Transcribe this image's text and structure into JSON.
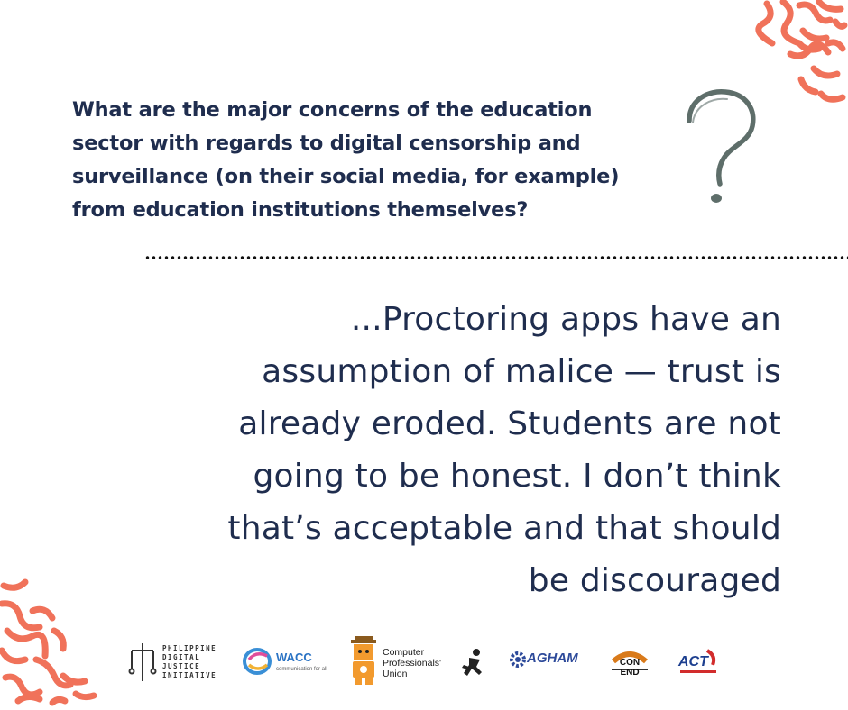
{
  "question": "What are the major concerns of the education\nsector with regards to digital censorship and\nsurveillance (on their social media, for example)\nfrom education institutions themselves?",
  "quote": "...Proctoring apps have an\nassumption of malice — trust is\nalready eroded. Students are not\ngoing to be honest. I don’t think\nthat’s acceptable and that should\nbe discouraged",
  "logos": {
    "pdji": "PHILIPPINE\nDIGITAL\nJUSTICE\nINITIATIVE",
    "wacc_name": "WACC",
    "wacc_tagline": "communication for all",
    "cpu": "Computer\nProfessionals'\nUnion",
    "agham": "AGHAM",
    "conend": "CON END",
    "act": "ACT"
  },
  "colors": {
    "text": "#1f2d4e",
    "accent": "#f0725a",
    "question_mark": "#5e6e6a"
  },
  "icons": [
    "question-mark-icon",
    "squiggle-pattern"
  ]
}
